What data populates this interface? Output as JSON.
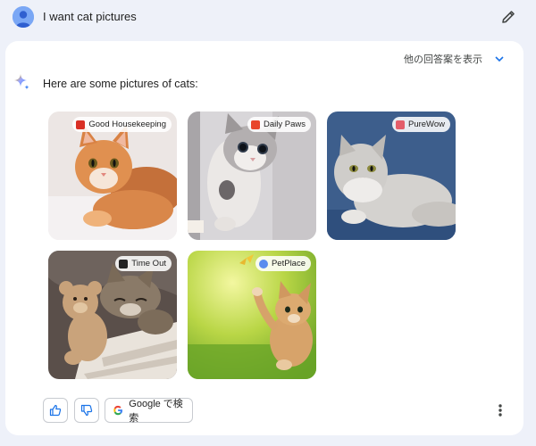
{
  "prompt": {
    "text": "I want cat pictures"
  },
  "response": {
    "drafts_label": "他の回答案を表示",
    "intro": "Here are some pictures of cats:",
    "images": [
      {
        "source": "Good Housekeeping",
        "favicon_color": "#d93025",
        "alt": "orange kitten"
      },
      {
        "source": "Daily Paws",
        "favicon_color": "#e8452c",
        "alt": "grey kitten"
      },
      {
        "source": "PureWow",
        "favicon_color": "#e35d6a",
        "alt": "fluffy grey cat"
      },
      {
        "source": "Time Out",
        "favicon_color": "#222222",
        "alt": "tabby cat with teddy bear"
      },
      {
        "source": "PetPlace",
        "favicon_color": "#5b8dee",
        "alt": "kitten in grass"
      }
    ],
    "actions": {
      "google_label": "Google で検索"
    }
  },
  "colors": {
    "page_bg": "#eef1f9",
    "card_bg": "#ffffff",
    "accent": "#1a73e8"
  }
}
